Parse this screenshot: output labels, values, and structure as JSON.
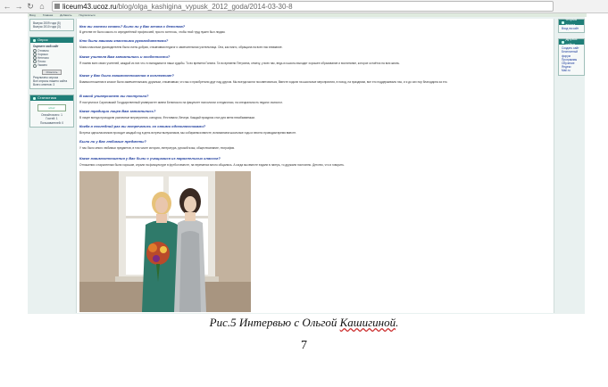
{
  "browser": {
    "url_host": "liceum43.ucoz.ru",
    "url_path": "/blog/olga_kashigina_vypusk_2012_goda/2014-03-30-8"
  },
  "site_nav": [
    "Вход",
    "Главная",
    "Добавить",
    "Подписаться"
  ],
  "left_sidebar": {
    "top_links": [
      "Выпуск 2009 года (5)",
      "Выпуск 2010 года (3)"
    ],
    "poll": {
      "title": "Опрос",
      "question": "Оцените мой сайт",
      "options": [
        "Отлично",
        "Хорошо",
        "Неплохо",
        "Плохо",
        "Ужасно"
      ],
      "submit": "Ответить",
      "results": "Результаты опроса",
      "archive": "Все опросы нашего сайта",
      "total": "Всего ответов: 3"
    },
    "stats": {
      "title": "Статистика",
      "counter": "uCoz",
      "online": "Онлайн всего: 1",
      "guests": "Гостей: 1",
      "users": "Пользователей: 0"
    }
  },
  "right_sidebar": {
    "login_title": "Форма входа",
    "login_link": "Вход на сайт",
    "friends_title": "Друзья сайта",
    "friends_links": [
      "Создать сайт",
      "Бесплатный форум",
      "Программы",
      "Обучение",
      "Яндекс",
      "Mail.ru"
    ]
  },
  "article": [
    {
      "q": "Кем вы хотели стать? Было ли у Вас мечта с детства?",
      "a": "В детстве не было какого-то определённой профессией, просто хотелось, чтобы твой труд нужен был людям."
    },
    {
      "q": "Кто были вашими классными руководителями?",
      "a": "Моим классным руководителем была очень добрая, отзывчивая педагог и замечательная учительница. Она, как никто, обращала на всех нас внимание."
    },
    {
      "q": "Какие учителя Вам запомнились и особенности?",
      "a": "Я помню всех своих учителей, каждый из них что-то вкладывал в наши судьбы. То во времени Галина. Та во времени Петровна, отмечу, у всех нас, ведь из школы выходит хорошее образование и воспитание, которое остаётся на всю жизнь."
    },
    {
      "q": "Какие у Вас были взаимоотношения в коллективе?",
      "a": "Взаимоотношения в классе были замечательными, дружным, отзывчивым, что мы и приобретали друг над другом. Мы всегда могли посоветоваться, Вместе ходили на школьные мероприятия, в поход, на праздники, все это поддерживало нас, и я до сих пор благодарна за это."
    },
    {
      "q": "В какой университет вы поступили?",
      "a": "Я поступила в Саратовский Государственный университет имени Белинского на факультет психологии и педагогики, на специальность педагог-психолог."
    },
    {
      "q": "Какие традиции лицея Вам запомнились?",
      "a": "В лицее всегда проходили различные мероприятия, конкурсы, Фестивали, Вечера. Каждый праздник стал для меня незабываемым."
    },
    {
      "q": "Когда в последний раз вы встречались со своими одноклассниками?",
      "a": "Встреча одноклассников проходит каждый год в день встречи выпускников, мы собираемся вместе, вспоминаем школьные годы и весело проводим время вместе."
    },
    {
      "q": "Были ли у Вас любимые предметы?",
      "a": "У нас было много любимых предметов, в том числе история, литература, русский язык, обществознание, география."
    },
    {
      "q": "Какие взаимоотношения у Вас были с учащимися из параллельных классов?",
      "a": "Отношения с параллелью были хорошие, играли на физкультуре в футбол вместе, на переменах много общались. А когда мы вместе ездили в лагерь, то дружили постоянно. Детство, что и говорить."
    }
  ],
  "caption": {
    "prefix": "Рис.5  Интервью с Ольгой ",
    "name": "Кашигиной",
    "suffix": "."
  },
  "page_number": "7"
}
